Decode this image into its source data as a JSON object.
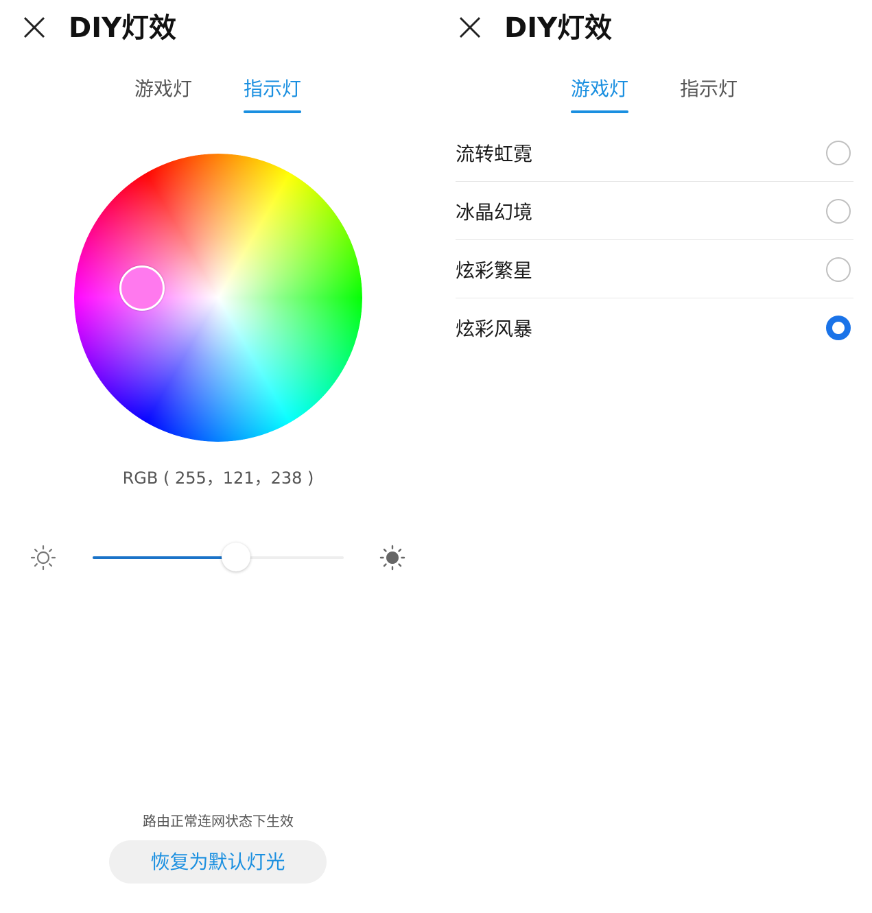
{
  "left_panel": {
    "title": "DIY灯效",
    "tabs": [
      {
        "label": "游戏灯",
        "active": false
      },
      {
        "label": "指示灯",
        "active": true
      }
    ],
    "color_picker": {
      "selected_color": "#ff79ee",
      "rgb_text": "RGB ( 255，121，238 )"
    },
    "brightness": {
      "value_fraction": 0.57,
      "fill_color": "#1a73c8"
    },
    "hint": "路由正常连网状态下生效",
    "restore_button": "恢复为默认灯光"
  },
  "right_panel": {
    "title": "DIY灯效",
    "tabs": [
      {
        "label": "游戏灯",
        "active": true
      },
      {
        "label": "指示灯",
        "active": false
      }
    ],
    "effects": [
      {
        "label": "流转虹霓",
        "selected": false
      },
      {
        "label": "冰晶幻境",
        "selected": false
      },
      {
        "label": "炫彩繁星",
        "selected": false
      },
      {
        "label": "炫彩风暴",
        "selected": true
      }
    ]
  },
  "colors": {
    "accent": "#1a8fe0",
    "radio_selected": "#1a73e8"
  },
  "icons": {
    "close": "close-icon",
    "brightness_low": "sun-outline-icon",
    "brightness_high": "sun-filled-icon"
  }
}
